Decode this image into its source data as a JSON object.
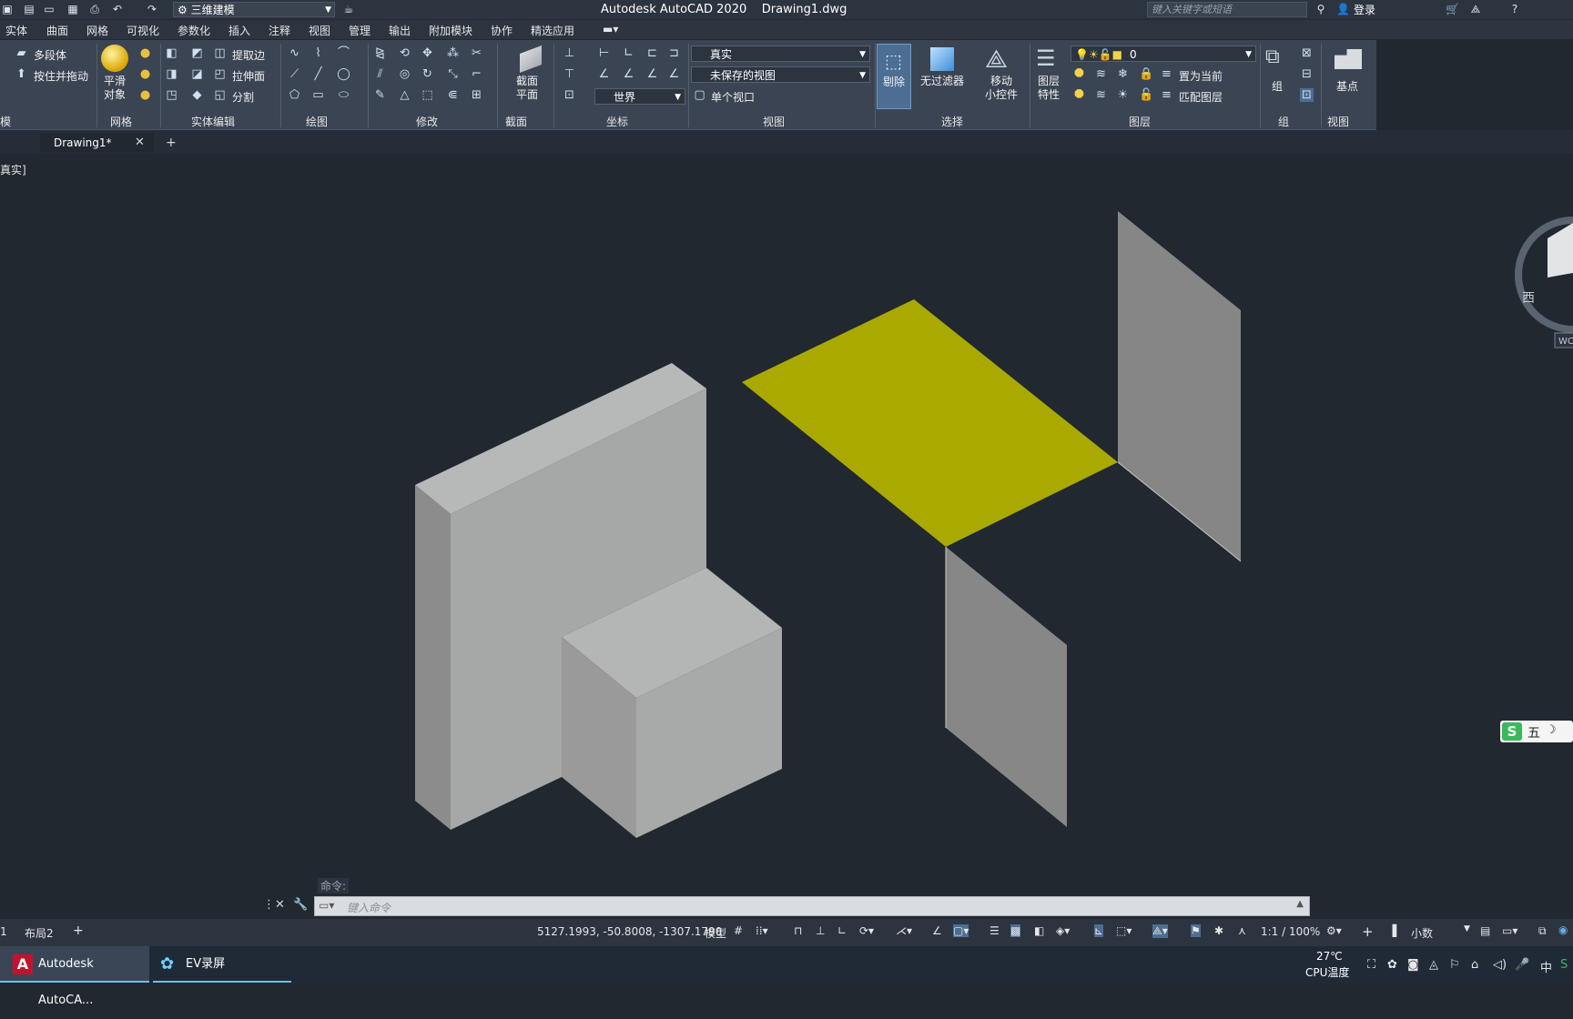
{
  "window": {
    "app_title": "Autodesk AutoCAD 2020",
    "file_title": "Drawing1.dwg",
    "workspace": "三维建模",
    "search_placeholder": "键入关键字或短语",
    "login": "登录"
  },
  "menu": [
    "实体",
    "曲面",
    "网格",
    "可视化",
    "参数化",
    "插入",
    "注释",
    "视图",
    "管理",
    "输出",
    "附加模块",
    "协作",
    "精选应用"
  ],
  "ribbon": {
    "modeling": {
      "polysolid": "多段体",
      "presspull": "按住并拖动",
      "label": "模"
    },
    "mesh": {
      "smooth": "平滑\n对象",
      "label": "网格"
    },
    "solid_editing": {
      "extract_edges": "提取边",
      "extrude_face": "拉伸面",
      "separate": "分割",
      "label": "实体编辑"
    },
    "draw": {
      "label": "绘图"
    },
    "modify": {
      "label": "修改"
    },
    "section": {
      "plane": "截面\n平面",
      "label": "截面"
    },
    "coordinates": {
      "ucs": "世界",
      "label": "坐标"
    },
    "view": {
      "visual_style": "真实",
      "named_view": "未保存的视图",
      "viewport": "单个视口",
      "label": "视图"
    },
    "selection": {
      "culling": "剔除",
      "filter": "无过滤器",
      "gizmo": "移动\n小控件",
      "label": "选择"
    },
    "layers": {
      "properties": "图层\n特性",
      "layer_name": "0",
      "make_current": "置为当前",
      "match_layer": "匹配图层",
      "label": "图层"
    },
    "groups": {
      "group": "组",
      "label": "组"
    },
    "view2": {
      "base_point": "基点",
      "label": "视图"
    }
  },
  "tabs": {
    "drawing": "Drawing1*"
  },
  "viewport": {
    "label": "真实]"
  },
  "viewcube": {
    "west": "西",
    "wcs": "WC"
  },
  "ime": {
    "mode": "五"
  },
  "command": {
    "hint": "命令:",
    "placeholder": "键入命令"
  },
  "layout_tabs": {
    "layout1": "1",
    "layout2": "布局2"
  },
  "status": {
    "coordinates": "5127.1993, -50.8008, -1307.1790",
    "model": "模型",
    "scale": "1:1 / 100%",
    "units": "小数"
  },
  "taskbar": {
    "autocad": "Autodesk AutoCA...",
    "ev": "EV录屏",
    "temperature": "27℃",
    "cpu": "CPU温度",
    "lang": "中"
  },
  "colors": {
    "background": "#212830",
    "ribbon": "#3b4453",
    "face_selected": "#a9a900",
    "solid_light": "#a6a7a7",
    "solid_dark": "#858585"
  }
}
